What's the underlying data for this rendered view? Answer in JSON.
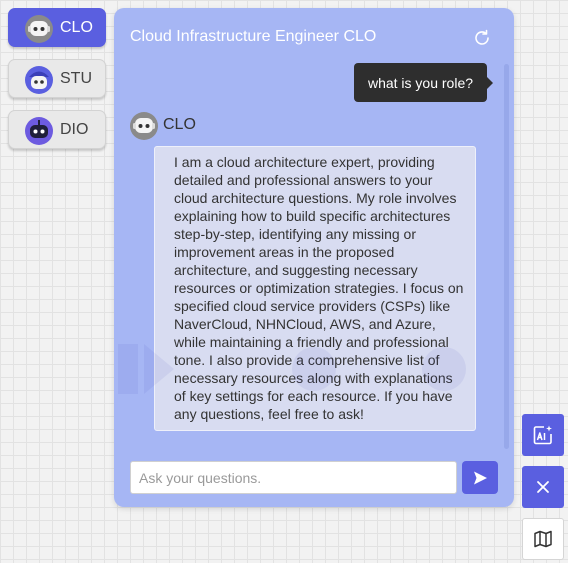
{
  "agents": [
    {
      "label": "CLO",
      "avatar": "robot-avatar-icon",
      "active": true
    },
    {
      "label": "STU",
      "avatar": "robot-cap-avatar-icon",
      "active": false
    },
    {
      "label": "DIO",
      "avatar": "purple-robot-avatar-icon",
      "active": false
    }
  ],
  "chat": {
    "title": "Cloud Infrastructure Engineer CLO",
    "refresh_icon": "refresh-icon",
    "user_message": "what is you role?",
    "bot_name": "CLO",
    "bot_message": "I am a cloud architecture expert, providing detailed and professional answers to your cloud architecture questions. My role involves explaining how to build specific architectures step-by-step, identifying any missing or improvement areas in the proposed architecture, and suggesting necessary resources or optimization strategies. I focus on specified cloud service providers (CSPs) like NaverCloud, NHNCloud, AWS, and Azure, while maintaining a friendly and professional tone. I also provide a comprehensive list of necessary resources along with explanations of key settings for each resource. If you have any questions, feel free to ask!",
    "input_placeholder": "Ask your questions.",
    "input_value": "",
    "send_icon": "send-icon"
  },
  "side_tools": [
    {
      "icon": "ai-image-icon"
    },
    {
      "icon": "close-icon"
    },
    {
      "icon": "map-icon"
    }
  ],
  "colors": {
    "accent": "#5a5fe0",
    "panel": "#a6b6f4",
    "bot_bubble": "#d8dcf1",
    "user_bubble": "#2e2e2e"
  }
}
